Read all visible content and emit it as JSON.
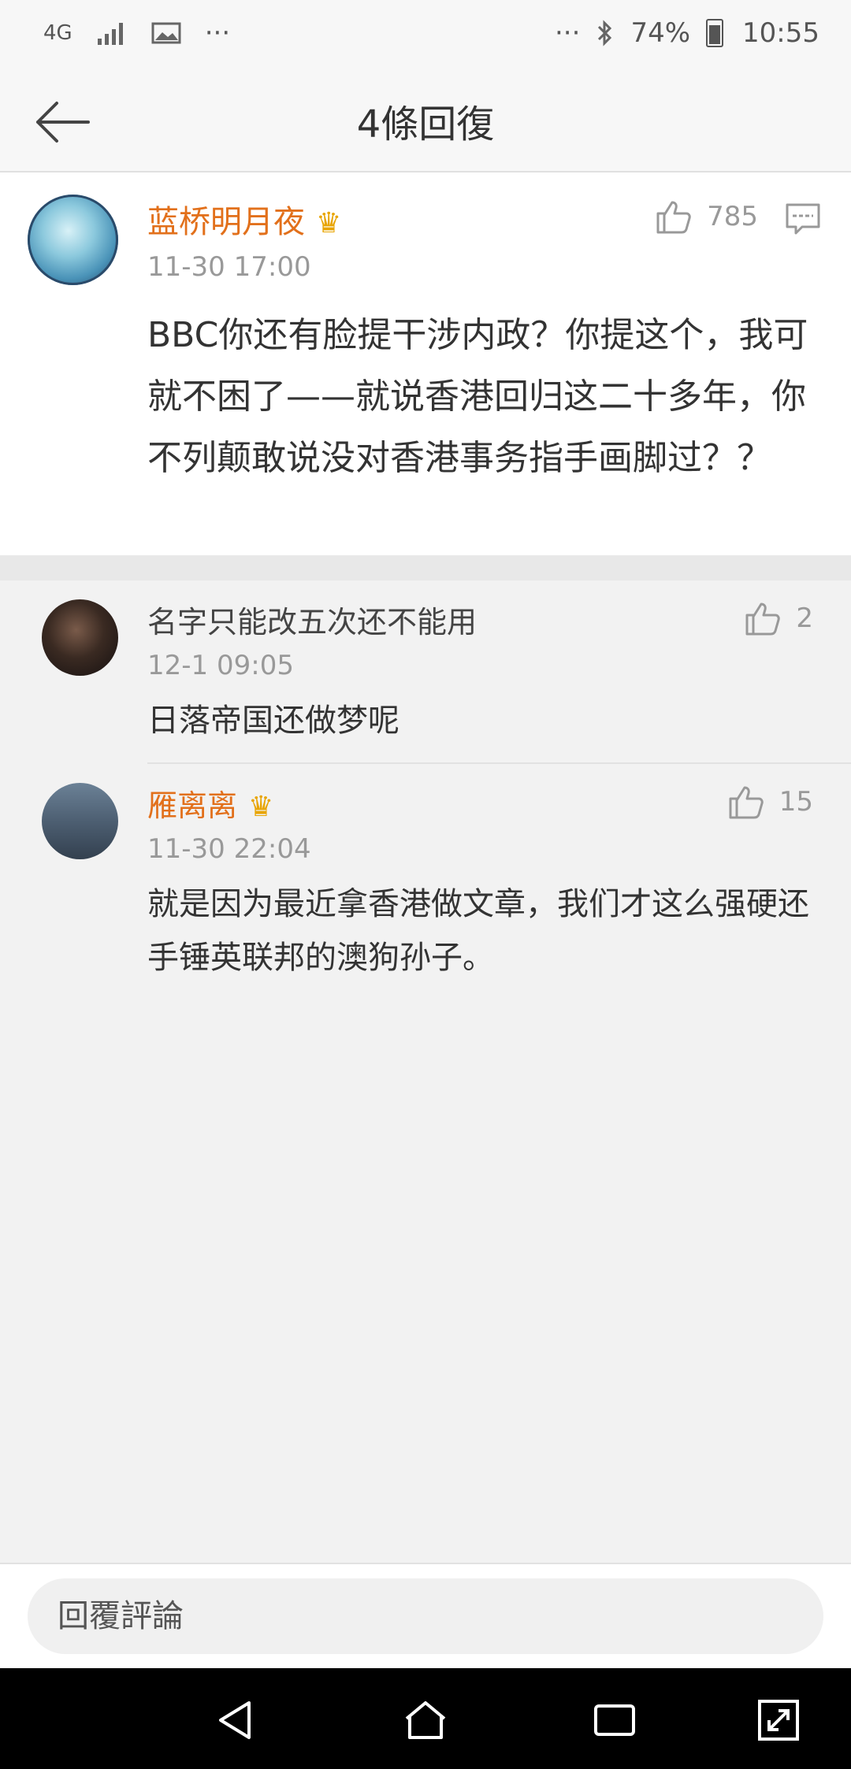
{
  "status_bar": {
    "network": "4G",
    "dots_left": "···",
    "dots_right": "···",
    "battery": "74%",
    "time": "10:55"
  },
  "header": {
    "title": "4條回復"
  },
  "main_post": {
    "username": "蓝桥明月夜",
    "time": "11-30 17:00",
    "likes": "785",
    "text": "BBC你还有脸提干涉内政？你提这个，我可就不困了——就说香港回归这二十多年，你不列颠敢说没对香港事务指手画脚过？？"
  },
  "replies": [
    {
      "username": "名字只能改五次还不能用",
      "time": "12-1 09:05",
      "likes": "2",
      "text": "日落帝国还做梦呢"
    },
    {
      "username": "雁离离",
      "time": "11-30 22:04",
      "likes": "15",
      "text": "就是因为最近拿香港做文章，我们才这么强硬还手锤英联邦的澳狗孙子。"
    }
  ],
  "input": {
    "placeholder": "回覆評論"
  },
  "colors": {
    "username_vip": "#e2701b",
    "text": "#333333",
    "meta": "#999999"
  },
  "icons": [
    "back-arrow-icon",
    "thumbs-up-icon",
    "comment-icon",
    "crown-icon",
    "nav-back-icon",
    "nav-home-icon",
    "nav-recents-icon",
    "nav-expand-icon"
  ]
}
